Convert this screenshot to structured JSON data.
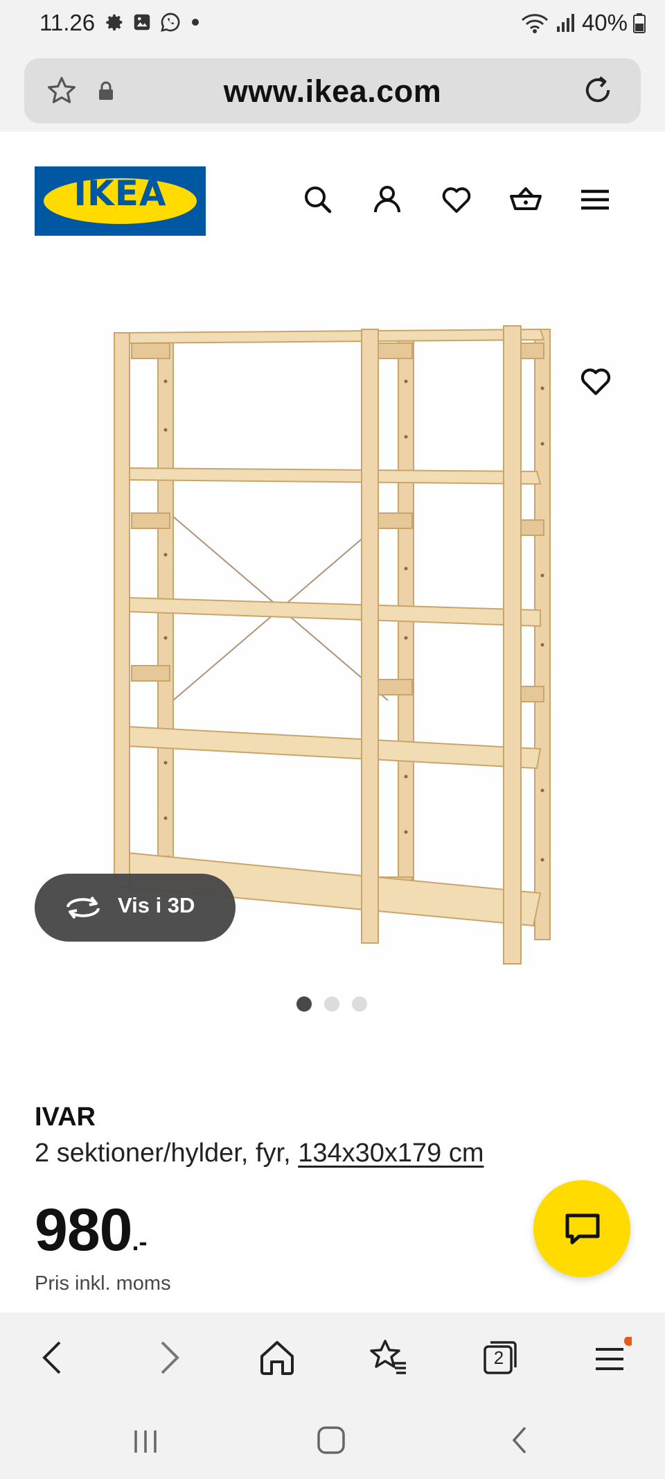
{
  "status_bar": {
    "time": "11.26",
    "battery": "40%",
    "left_icons": [
      "gear-icon",
      "image-icon",
      "whatsapp-icon",
      "dot-icon"
    ],
    "right_icons": [
      "wifi-icon",
      "signal-icon",
      "battery-icon"
    ]
  },
  "browser": {
    "url": "www.ikea.com",
    "tab_count": "2",
    "nav_icons": [
      "back-icon",
      "forward-icon",
      "home-icon",
      "bookmarks-icon",
      "tabs-icon",
      "menu-icon"
    ]
  },
  "header": {
    "logo_text": "IKEA",
    "icons": [
      "search-icon",
      "account-icon",
      "heart-icon",
      "basket-icon",
      "menu-icon"
    ]
  },
  "product": {
    "view_3d_label": "Vis i 3D",
    "carousel": {
      "total": 3,
      "active": 1
    },
    "name": "IVAR",
    "description": "2 sektioner/hylder, fyr, ",
    "dimensions": "134x30x179 cm",
    "price": "980",
    "price_suffix": ".-",
    "price_note": "Pris inkl. moms"
  },
  "colors": {
    "ikea_blue": "#0058a3",
    "ikea_yellow": "#ffdb00",
    "wood": "#efd6ac",
    "notification_dot": "#e8571b"
  }
}
